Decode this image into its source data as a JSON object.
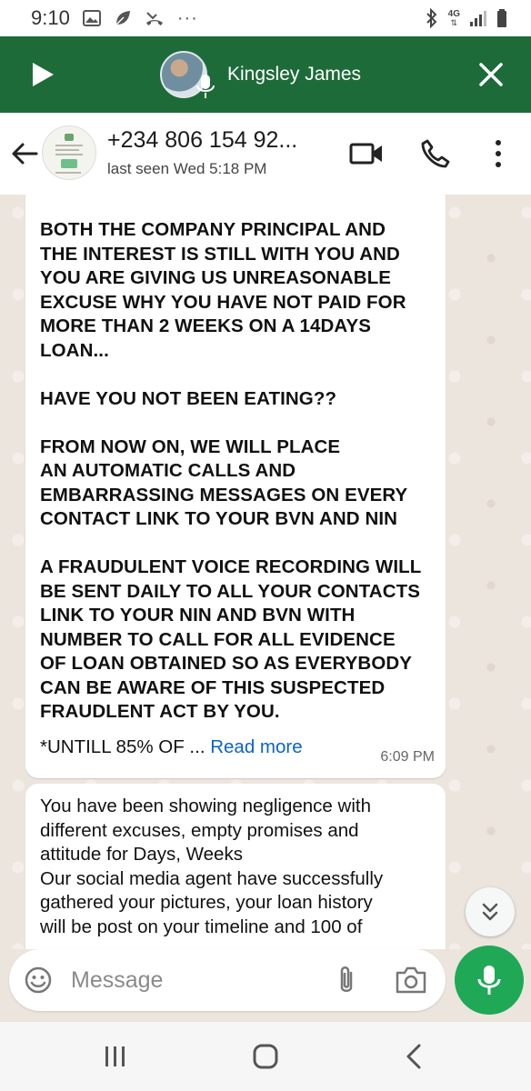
{
  "status_bar": {
    "time": "9:10",
    "more": "···",
    "network": "4G"
  },
  "call_banner": {
    "name": "Kingsley James",
    "bg_color": "#1e6b3a"
  },
  "header": {
    "contact_name": "+234 806 154 92...",
    "last_seen": "last seen Wed 5:18 PM"
  },
  "messages": [
    {
      "lines": [
        "BOTH THE COMPANY PRINCIPAL AND",
        "THE INTEREST IS STILL WITH YOU AND",
        "YOU ARE GIVING US UNREASONABLE",
        "EXCUSE WHY YOU  HAVE NOT PAID FOR",
        "MORE THAN 2 WEEKS ON A 14DAYS",
        "LOAN...",
        "",
        "HAVE YOU NOT BEEN EATING??",
        "",
        "FROM NOW ON, WE WILL PLACE",
        "AN AUTOMATIC CALLS AND",
        "EMBARRASSING MESSAGES ON EVERY",
        "CONTACT LINK TO YOUR BVN AND NIN",
        "",
        "A FRAUDULENT VOICE RECORDING WILL",
        "BE SENT DAILY TO ALL YOUR CONTACTS",
        "LINK TO YOUR NIN AND BVN WITH",
        "NUMBER TO CALL FOR ALL EVIDENCE",
        "OF LOAN OBTAINED SO  AS EVERYBODY",
        "CAN BE AWARE OF THIS SUSPECTED",
        "FRAUDLENT ACT BY YOU."
      ],
      "truncated_text": "*UNTILL 85% OF ... ",
      "read_more": "Read more",
      "time": "6:09 PM"
    },
    {
      "lines": [
        "You have been showing negligence with",
        "different excuses, empty promises and",
        "attitude for Days, Weeks",
        "Our social media agent have successfully",
        "gathered your pictures, your loan history",
        "will be post on your timeline and 100 of"
      ]
    }
  ],
  "input": {
    "placeholder": "Message"
  },
  "colors": {
    "accent_green": "#1fa855",
    "link_blue": "#0b63c9"
  }
}
